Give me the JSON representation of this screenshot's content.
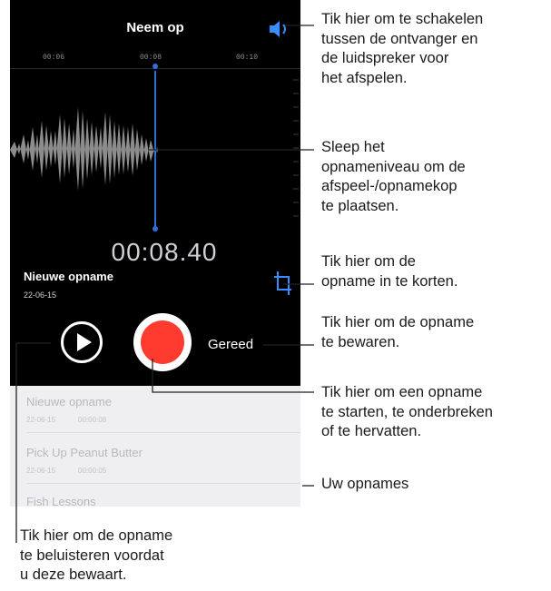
{
  "screen": {
    "title": "Neem op",
    "timeline_ticks": [
      "00:06",
      "00:08",
      "00:10"
    ],
    "timer": "00:08.40",
    "recording_name": "Nieuwe opname",
    "recording_date": "22-06-15",
    "done_label": "Gereed",
    "accent_color": "#ff3b30"
  },
  "recordings": [
    {
      "name": "Nieuwe opname",
      "date": "22-06-15",
      "duration": "00:00:08"
    },
    {
      "name": "Pick Up Peanut Butter",
      "date": "22-06-15",
      "duration": "00:00:05"
    },
    {
      "name": "Fish Lessons",
      "date": "",
      "duration": ""
    }
  ],
  "callouts": {
    "speaker": "Tik hier om te schakelen\ntussen de ontvanger en\nde luidspreker voor\nhet afspelen.",
    "playhead": "Sleep het\nopnameniveau om de\nafspeel-/opnamekop\nte plaatsen.",
    "trim": "Tik hier om de\nopname in te korten.",
    "done": "Tik hier om de opname\nte bewaren.",
    "record": "Tik hier om een opname\nte starten, te onderbreken\nof te hervatten.",
    "list": "Uw opnames",
    "play": "Tik hier om de opname\nte beluisteren voordat\nu deze bewaart."
  }
}
